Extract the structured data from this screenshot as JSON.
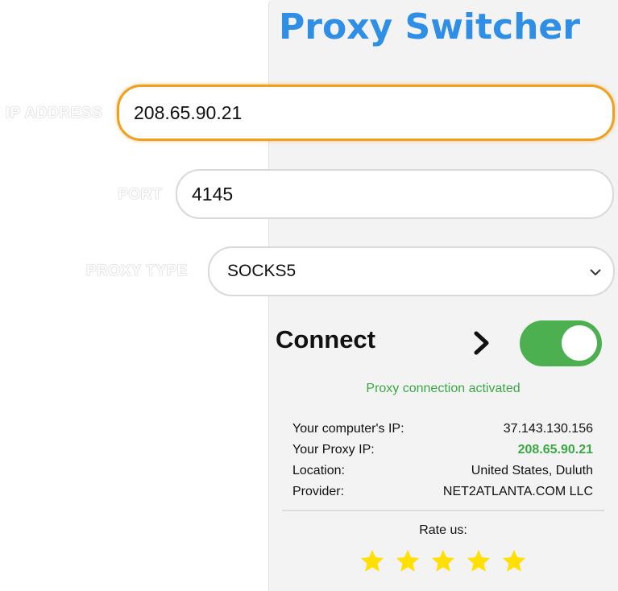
{
  "app": {
    "title": "Proxy Switcher"
  },
  "form": {
    "ip_label": "IP ADDRESS",
    "ip_value": "208.65.90.21",
    "port_label": "PORT",
    "port_value": "4145",
    "type_label": "PROXY TYPE",
    "type_value": "SOCKS5"
  },
  "connect": {
    "label": "Connect",
    "toggle_on": true,
    "status": "Proxy connection activated"
  },
  "info": [
    {
      "key": "Your computer's IP:",
      "value": "37.143.130.156"
    },
    {
      "key": "Your Proxy IP:",
      "value": "208.65.90.21"
    },
    {
      "key": "Location:",
      "value": "United States, Duluth"
    },
    {
      "key": "Provider:",
      "value": "NET2ATLANTA.COM LLC"
    }
  ],
  "rating": {
    "label": "Rate us:",
    "stars": 5
  },
  "colors": {
    "title": "#2f8fe6",
    "focus_border": "#f0a020",
    "toggle_on": "#4caf50",
    "status_green": "#3aa844",
    "star": "#ffe000"
  },
  "icons": [
    "chevron-down-icon",
    "chevron-right-icon",
    "star-icon"
  ]
}
